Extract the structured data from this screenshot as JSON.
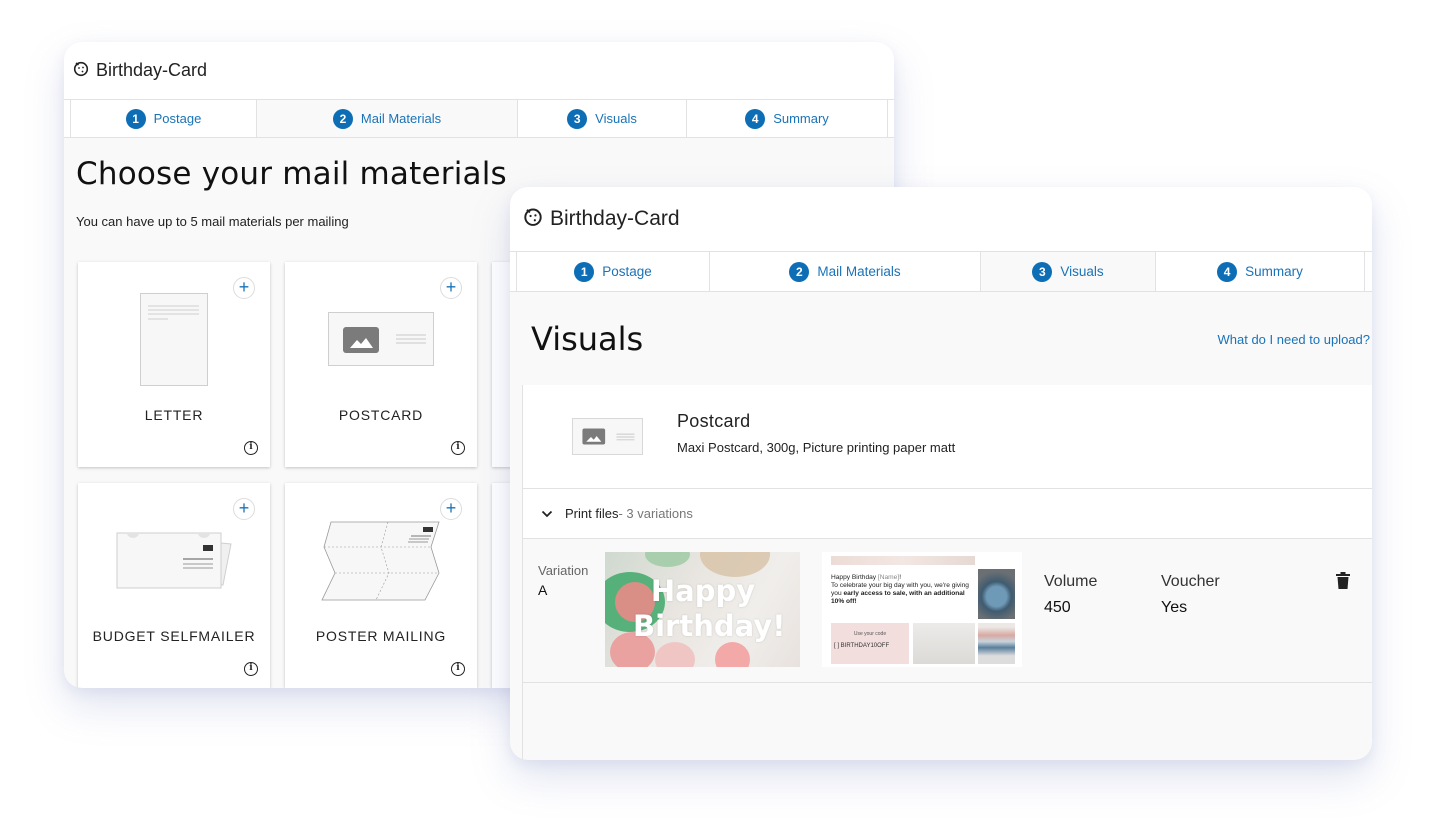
{
  "left_window": {
    "title": "Birthday-Card",
    "tabs": [
      {
        "num": "1",
        "label": "Postage",
        "active": false
      },
      {
        "num": "2",
        "label": "Mail Materials",
        "active": true
      },
      {
        "num": "3",
        "label": "Visuals",
        "active": false
      },
      {
        "num": "4",
        "label": "Summary",
        "active": false
      }
    ],
    "page_title": "Choose your mail materials",
    "subtitle": "You can have up to 5 mail materials per mailing",
    "cards": [
      {
        "label": "LETTER",
        "icon": "letter-icon"
      },
      {
        "label": "POSTCARD",
        "icon": "postcard-icon"
      },
      {
        "label": "BUDGET SELFMAILER",
        "icon": "selfmailer-icon"
      },
      {
        "label": "POSTER MAILING",
        "icon": "poster-mailing-icon"
      }
    ],
    "add_symbol": "+",
    "info_symbol": "i"
  },
  "right_window": {
    "title": "Birthday-Card",
    "tabs": [
      {
        "num": "1",
        "label": "Postage",
        "active": false
      },
      {
        "num": "2",
        "label": "Mail Materials",
        "active": false
      },
      {
        "num": "3",
        "label": "Visuals",
        "active": true
      },
      {
        "num": "4",
        "label": "Summary",
        "active": false
      }
    ],
    "page_title": "Visuals",
    "help_link": "What do I need to upload?",
    "product": {
      "name": "Postcard",
      "description": "Maxi Postcard, 300g, Picture printing paper matt"
    },
    "print_files": {
      "label": "Print files",
      "count_text": " - 3 variations"
    },
    "variation": {
      "label": "Variation",
      "value": "A",
      "front_headline_1": "Happy",
      "front_headline_2": "Birthday!",
      "back_greeting": "Happy Birthday ",
      "back_name_placeholder": "[Name]",
      "back_greeting_end": "!",
      "back_body": "To celebrate your big day with you, we're giving you ",
      "back_body_bold": "early access to sale, with an additional 10% off!",
      "back_code_label": "Use your code",
      "back_code": "[      ]  BIRTHDAY10OFF",
      "volume_label": "Volume",
      "volume_value": "450",
      "voucher_label": "Voucher",
      "voucher_value": "Yes"
    }
  },
  "colors": {
    "accent": "#0d6eb5",
    "link": "#1a73b8",
    "background": "#f9f9f9",
    "border": "#e2e2e2"
  }
}
